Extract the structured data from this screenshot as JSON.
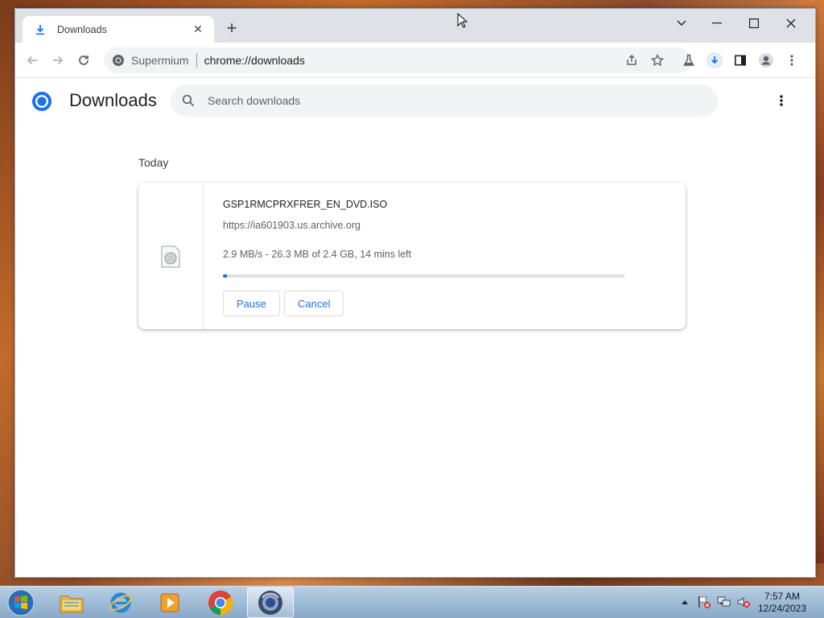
{
  "browser": {
    "tab_title": "Downloads",
    "site_name": "Supermium",
    "url": "chrome://downloads"
  },
  "page": {
    "title": "Downloads",
    "search_placeholder": "Search downloads",
    "section_label": "Today"
  },
  "download": {
    "file_name": "GSP1RMCPRXFRER_EN_DVD.ISO",
    "source_url": "https://ia601903.us.archive.org",
    "status": "2.9 MB/s - 26.3 MB of 2.4 GB, 14 mins left",
    "progress_percent": 1.1,
    "pause_label": "Pause",
    "cancel_label": "Cancel"
  },
  "taskbar": {
    "apps": [
      "file-explorer-icon",
      "internet-explorer-icon",
      "media-player-icon",
      "chrome-icon",
      "supermium-icon"
    ],
    "time": "7:57 AM",
    "date": "12/24/2023"
  },
  "colors": {
    "accent": "#1a73e8",
    "tab_strip": "#dee1e6",
    "omnibox": "#f1f3f4"
  }
}
